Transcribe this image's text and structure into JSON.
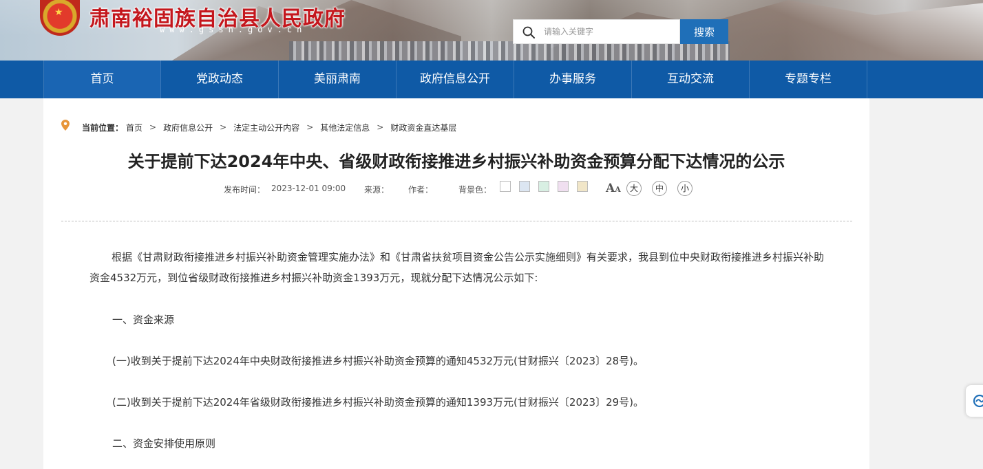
{
  "header": {
    "site_title": "肃南裕固族自治县人民政府",
    "site_url": "www.gssn.gov.cn",
    "search_placeholder": "请输入关键字",
    "search_button": "搜索"
  },
  "nav": {
    "items": [
      "首页",
      "党政动态",
      "美丽肃南",
      "政府信息公开",
      "办事服务",
      "互动交流",
      "专题专栏"
    ]
  },
  "breadcrumb": {
    "label": "当前位置：",
    "items": [
      "首页",
      "政府信息公开",
      "法定主动公开内容",
      "其他法定信息",
      "财政资金直达基层"
    ],
    "separator": ">"
  },
  "article": {
    "title": "关于提前下达2024年中央、省级财政衔接推进乡村振兴补助资金预算分配下达情况的公示",
    "meta": {
      "publish_label": "发布时间：",
      "publish_time": "2023-12-01 09:00",
      "source_label": "来源：",
      "author_label": "作者：",
      "bg_label": "背景色："
    },
    "bg_colors": [
      "#ffffff",
      "#dce6f2",
      "#d8efe3",
      "#f0dff0",
      "#f1e6c8"
    ],
    "font_sizes": [
      "大",
      "中",
      "小"
    ],
    "paragraphs": [
      "根据《甘肃财政衔接推进乡村振兴补助资金管理实施办法》和《甘肃省扶贫项目资金公告公示实施细则》有关要求，我县到位中央财政衔接推进乡村振兴补助资金4532万元，到位省级财政衔接推进乡村振兴补助资金1393万元，现就分配下达情况公示如下:",
      "一、资金来源",
      "(一)收到关于提前下达2024年中央财政衔接推进乡村振兴补助资金预算的通知4532万元(甘财振兴〔2023〕28号)。",
      "(二)收到关于提前下达2024年省级财政衔接推进乡村振兴补助资金预算的通知1393万元(甘财振兴〔2023〕29号)。",
      "二、资金安排使用原则"
    ]
  }
}
